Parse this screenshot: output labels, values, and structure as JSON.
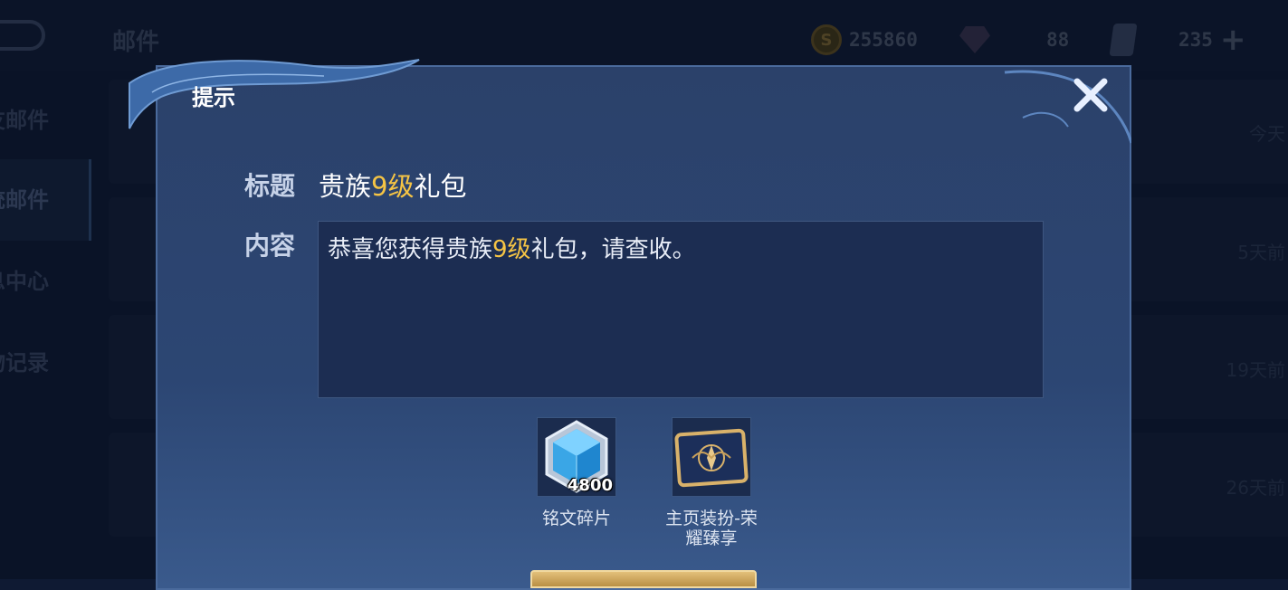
{
  "background": {
    "title": "邮件",
    "resources": {
      "coins": "255860",
      "gems": "88",
      "cards": "235"
    },
    "sidebar": [
      "友邮件",
      "统邮件",
      "息中心",
      "物记录"
    ],
    "mail_times": [
      "今天",
      "5天前",
      "19天前",
      "26天前"
    ]
  },
  "dialog": {
    "title": "提示",
    "subject_label": "标题",
    "subject": {
      "pre": "贵族",
      "level": "9级",
      "post": "礼包"
    },
    "content_label": "内容",
    "content": {
      "pre": "恭喜您获得贵族",
      "level": "9级",
      "post": "礼包，请查收。"
    },
    "rewards": [
      {
        "name": "铭文碎片",
        "quantity": "4800"
      },
      {
        "name_line1": "主页装扮-荣",
        "name_line2": "耀臻享"
      }
    ]
  },
  "colors": {
    "highlight": "#f5c445",
    "panel": "#2b416a"
  }
}
